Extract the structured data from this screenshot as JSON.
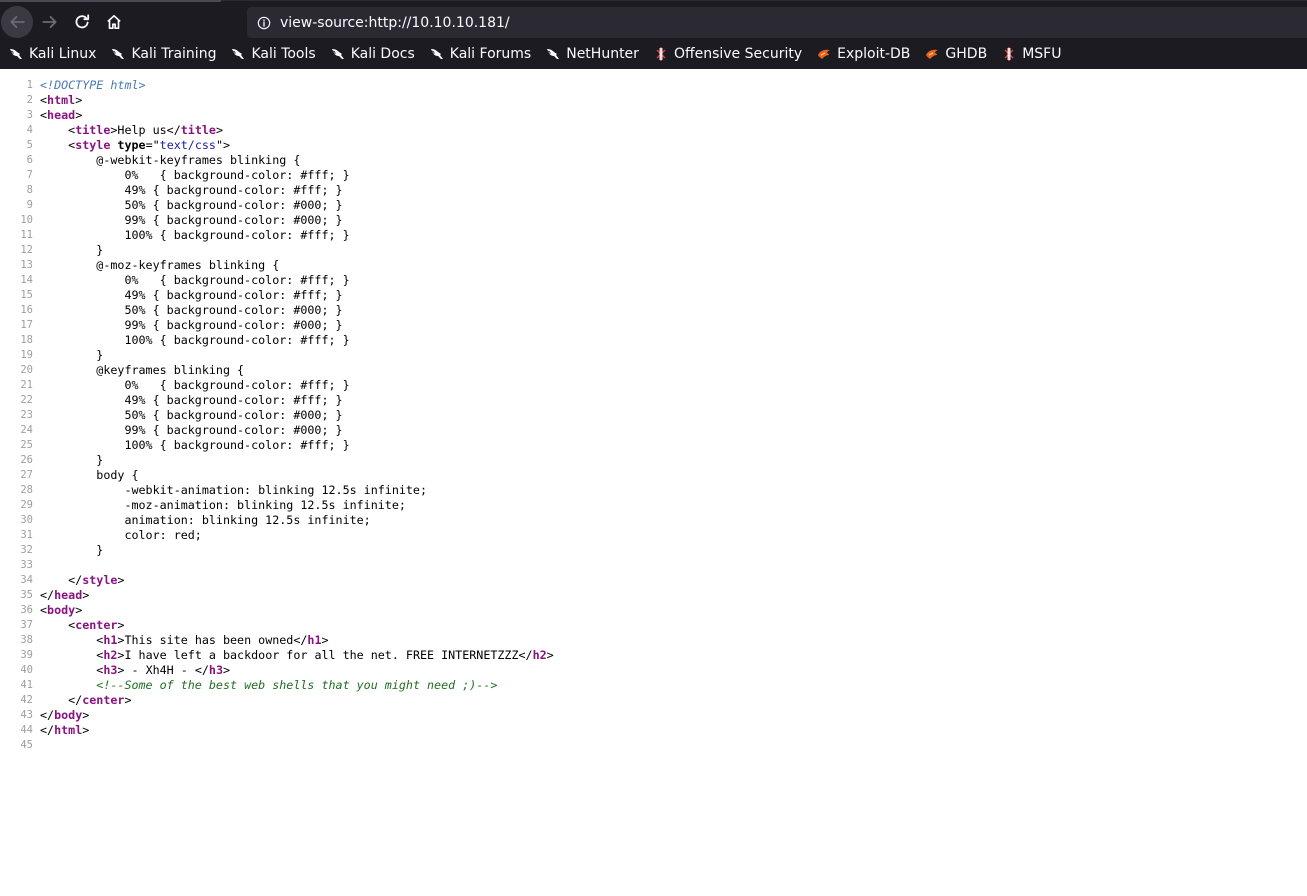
{
  "browser": {
    "url": "view-source:http://10.10.10.181/",
    "bookmarks": [
      {
        "label": "Kali Linux",
        "icon": "kali-dragon-icon"
      },
      {
        "label": "Kali Training",
        "icon": "kali-dragon-icon"
      },
      {
        "label": "Kali Tools",
        "icon": "kali-dragon-icon"
      },
      {
        "label": "Kali Docs",
        "icon": "kali-dragon-icon"
      },
      {
        "label": "Kali Forums",
        "icon": "kali-dragon-icon"
      },
      {
        "label": "NetHunter",
        "icon": "kali-dragon-icon"
      },
      {
        "label": "Offensive Security",
        "icon": "offsec-icon"
      },
      {
        "label": "Exploit-DB",
        "icon": "exploitdb-icon"
      },
      {
        "label": "GHDB",
        "icon": "exploitdb-icon"
      },
      {
        "label": "MSFU",
        "icon": "offsec-icon"
      }
    ]
  },
  "source_lines": [
    [
      {
        "t": "doctype",
        "v": "<!DOCTYPE html>"
      }
    ],
    [
      {
        "t": "txt",
        "v": "<"
      },
      {
        "t": "tag",
        "v": "html"
      },
      {
        "t": "txt",
        "v": ">"
      }
    ],
    [
      {
        "t": "txt",
        "v": "<"
      },
      {
        "t": "tag",
        "v": "head"
      },
      {
        "t": "txt",
        "v": ">"
      }
    ],
    [
      {
        "t": "txt",
        "v": "    <"
      },
      {
        "t": "tag",
        "v": "title"
      },
      {
        "t": "txt",
        "v": ">Help us</"
      },
      {
        "t": "tag",
        "v": "title"
      },
      {
        "t": "txt",
        "v": ">"
      }
    ],
    [
      {
        "t": "txt",
        "v": "    <"
      },
      {
        "t": "tag",
        "v": "style"
      },
      {
        "t": "txt",
        "v": " "
      },
      {
        "t": "attr",
        "v": "type"
      },
      {
        "t": "txt",
        "v": "=\""
      },
      {
        "t": "val",
        "v": "text/css"
      },
      {
        "t": "txt",
        "v": "\">"
      }
    ],
    [
      {
        "t": "txt",
        "v": "        @-webkit-keyframes blinking {"
      }
    ],
    [
      {
        "t": "txt",
        "v": "            0%   { background-color: #fff; }"
      }
    ],
    [
      {
        "t": "txt",
        "v": "            49% { background-color: #fff; }"
      }
    ],
    [
      {
        "t": "txt",
        "v": "            50% { background-color: #000; }"
      }
    ],
    [
      {
        "t": "txt",
        "v": "            99% { background-color: #000; }"
      }
    ],
    [
      {
        "t": "txt",
        "v": "            100% { background-color: #fff; }"
      }
    ],
    [
      {
        "t": "txt",
        "v": "        }"
      }
    ],
    [
      {
        "t": "txt",
        "v": "        @-moz-keyframes blinking {"
      }
    ],
    [
      {
        "t": "txt",
        "v": "            0%   { background-color: #fff; }"
      }
    ],
    [
      {
        "t": "txt",
        "v": "            49% { background-color: #fff; }"
      }
    ],
    [
      {
        "t": "txt",
        "v": "            50% { background-color: #000; }"
      }
    ],
    [
      {
        "t": "txt",
        "v": "            99% { background-color: #000; }"
      }
    ],
    [
      {
        "t": "txt",
        "v": "            100% { background-color: #fff; }"
      }
    ],
    [
      {
        "t": "txt",
        "v": "        }"
      }
    ],
    [
      {
        "t": "txt",
        "v": "        @keyframes blinking {"
      }
    ],
    [
      {
        "t": "txt",
        "v": "            0%   { background-color: #fff; }"
      }
    ],
    [
      {
        "t": "txt",
        "v": "            49% { background-color: #fff; }"
      }
    ],
    [
      {
        "t": "txt",
        "v": "            50% { background-color: #000; }"
      }
    ],
    [
      {
        "t": "txt",
        "v": "            99% { background-color: #000; }"
      }
    ],
    [
      {
        "t": "txt",
        "v": "            100% { background-color: #fff; }"
      }
    ],
    [
      {
        "t": "txt",
        "v": "        }"
      }
    ],
    [
      {
        "t": "txt",
        "v": "        body {"
      }
    ],
    [
      {
        "t": "txt",
        "v": "            -webkit-animation: blinking 12.5s infinite;"
      }
    ],
    [
      {
        "t": "txt",
        "v": "            -moz-animation: blinking 12.5s infinite;"
      }
    ],
    [
      {
        "t": "txt",
        "v": "            animation: blinking 12.5s infinite;"
      }
    ],
    [
      {
        "t": "txt",
        "v": "            color: red;"
      }
    ],
    [
      {
        "t": "txt",
        "v": "        }"
      }
    ],
    [],
    [
      {
        "t": "txt",
        "v": "    </"
      },
      {
        "t": "tag",
        "v": "style"
      },
      {
        "t": "txt",
        "v": ">"
      }
    ],
    [
      {
        "t": "txt",
        "v": "</"
      },
      {
        "t": "tag",
        "v": "head"
      },
      {
        "t": "txt",
        "v": ">"
      }
    ],
    [
      {
        "t": "txt",
        "v": "<"
      },
      {
        "t": "tag",
        "v": "body"
      },
      {
        "t": "txt",
        "v": ">"
      }
    ],
    [
      {
        "t": "txt",
        "v": "    <"
      },
      {
        "t": "tag",
        "v": "center"
      },
      {
        "t": "txt",
        "v": ">"
      }
    ],
    [
      {
        "t": "txt",
        "v": "        <"
      },
      {
        "t": "tag",
        "v": "h1"
      },
      {
        "t": "txt",
        "v": ">This site has been owned</"
      },
      {
        "t": "tag",
        "v": "h1"
      },
      {
        "t": "txt",
        "v": ">"
      }
    ],
    [
      {
        "t": "txt",
        "v": "        <"
      },
      {
        "t": "tag",
        "v": "h2"
      },
      {
        "t": "txt",
        "v": ">I have left a backdoor for all the net. FREE INTERNETZZZ</"
      },
      {
        "t": "tag",
        "v": "h2"
      },
      {
        "t": "txt",
        "v": ">"
      }
    ],
    [
      {
        "t": "txt",
        "v": "        <"
      },
      {
        "t": "tag",
        "v": "h3"
      },
      {
        "t": "txt",
        "v": "> - Xh4H - </"
      },
      {
        "t": "tag",
        "v": "h3"
      },
      {
        "t": "txt",
        "v": ">"
      }
    ],
    [
      {
        "t": "txt",
        "v": "        "
      },
      {
        "t": "cmt",
        "v": "<!--Some of the best web shells that you might need ;)-->"
      }
    ],
    [
      {
        "t": "txt",
        "v": "    </"
      },
      {
        "t": "tag",
        "v": "center"
      },
      {
        "t": "txt",
        "v": ">"
      }
    ],
    [
      {
        "t": "txt",
        "v": "</"
      },
      {
        "t": "tag",
        "v": "body"
      },
      {
        "t": "txt",
        "v": ">"
      }
    ],
    [
      {
        "t": "txt",
        "v": "</"
      },
      {
        "t": "tag",
        "v": "html"
      },
      {
        "t": "txt",
        "v": ">"
      }
    ],
    []
  ],
  "line_numbers": [
    "1",
    "2",
    "3",
    "4",
    "5",
    "6",
    "7",
    "8",
    "9",
    "10",
    "11",
    "12",
    "13",
    "14",
    "15",
    "16",
    "17",
    "18",
    "19",
    "20",
    "21",
    "22",
    "23",
    "24",
    "25",
    "26",
    "27",
    "28",
    "29",
    "30",
    "31",
    "32",
    "33",
    "34",
    "35",
    "36",
    "37",
    "38",
    "39",
    "40",
    "41",
    "42",
    "43",
    "44",
    "45"
  ],
  "colors": {
    "chrome_bg": "#1c1b22",
    "urlbar_bg": "#2b2a33",
    "tag": "#881280",
    "attr_value": "#1a1aa6",
    "comment": "#236e25",
    "doctype": "#4a78b5",
    "line_number": "#9e9e9e"
  }
}
